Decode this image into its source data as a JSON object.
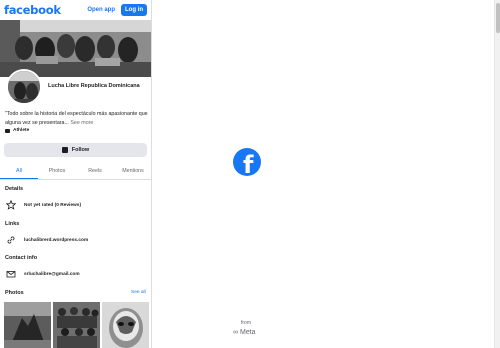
{
  "topbar": {
    "logo": "facebook",
    "open_app": "Open app",
    "login": "Log in"
  },
  "profile": {
    "name": "Lucha Libre Republica Dominicana",
    "bio": "\"Todo sobre la historia del espectáculo más apasionante que alguna vez se presentara...",
    "see_more": "See more",
    "category": "Athlete",
    "follow": "Follow"
  },
  "tabs": [
    {
      "label": "All",
      "active": true
    },
    {
      "label": "Photos",
      "active": false
    },
    {
      "label": "Reels",
      "active": false
    },
    {
      "label": "Mentions",
      "active": false
    }
  ],
  "details": {
    "title": "Details",
    "rating": "Not yet rated (0 Reviews)"
  },
  "links": {
    "title": "Links",
    "url": "luchalibrerd.wordpress.com"
  },
  "contact": {
    "title": "Contact info",
    "email": "srluchalibre@gmail.com"
  },
  "photos": {
    "title": "Photos",
    "see_all": "See all"
  },
  "footer": {
    "from": "from",
    "meta": "Meta"
  },
  "colors": {
    "brand_blue": "#1877f2",
    "secondary_text": "#65676b",
    "button_gray": "#e4e6eb"
  }
}
